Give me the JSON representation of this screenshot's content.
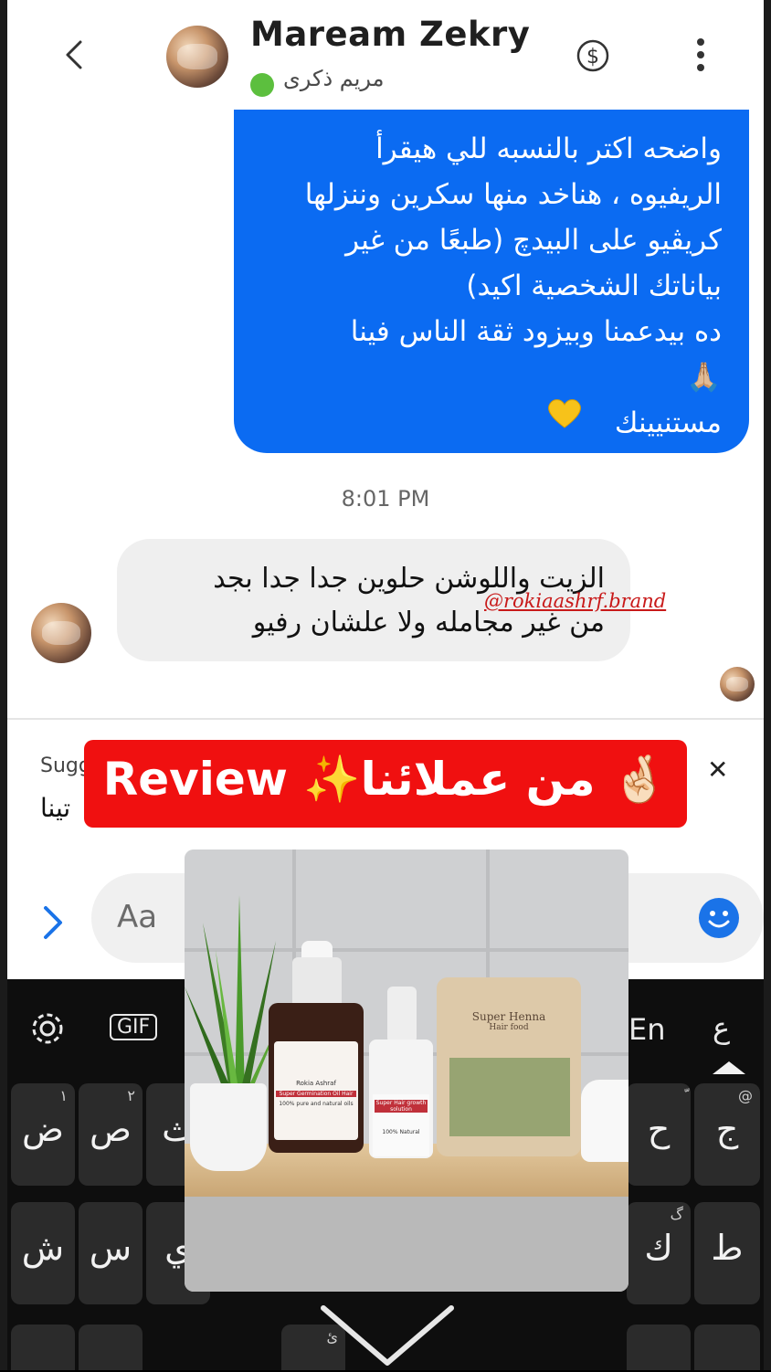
{
  "header": {
    "contact_name": "Maream Zekry",
    "contact_subname": "مريم ذكرى",
    "back_icon": "chevron-left-icon",
    "payment_icon": "dollar-circle-icon",
    "more_icon": "vertical-ellipsis-icon"
  },
  "sent_message": {
    "lines": [
      "واضحه اكتر بالنسبه للي هيقرأ",
      "الريفيوه ، هناخد منها سكرين وننزلها",
      "كريڤيو على البيدچ (طبعًا من غير",
      "بياناتك الشخصية اكيد)",
      "ده بيدعمنا وبيزود ثقة الناس فينا",
      "🙏🏼",
      "مستنيينك"
    ],
    "emoji": "yellow-heart-icon"
  },
  "timestamp": "8:01 PM",
  "received_message": {
    "lines": [
      "الزيت واللوشن حلوين جدا جدا بجد",
      "من غير مجامله ولا علشان رفيو"
    ]
  },
  "watermark": "@rokiaashrf.brand",
  "suggestion": {
    "label": "Sugg",
    "text": "تينا"
  },
  "composer": {
    "placeholder": "Aa",
    "expand_icon": "chevron-right-icon",
    "emoji_icon": "smiley-icon"
  },
  "banner": {
    "latin": "Review",
    "arabic": "من عملائنا✨",
    "emoji": "🤞🏻"
  },
  "keyboard": {
    "toolbar": {
      "settings_icon": "gear-icon",
      "gif_label": "GIF",
      "lang_label": "En",
      "alt_char": "ع"
    },
    "row1": [
      {
        "char": "ض",
        "sup": "١"
      },
      {
        "char": "ص",
        "sup": "٢"
      },
      {
        "char": "ث",
        "sup": ""
      },
      {
        "char": "ح",
        "sup": "ّ"
      },
      {
        "char": "ج",
        "sup": "@"
      }
    ],
    "row2": [
      {
        "char": "ش",
        "sup": ""
      },
      {
        "char": "س",
        "sup": ""
      },
      {
        "char": "ي",
        "sup": ""
      },
      {
        "char": "ك",
        "sup": "گ"
      },
      {
        "char": "ط",
        "sup": ""
      }
    ],
    "row3_hint": "ئ"
  },
  "product_photo": {
    "bottle1_label": "Super Germination Oil Hair",
    "bottle1_sub": "100% pure and natural oils",
    "bottle2_label": "Super Hair growth solution",
    "bottle2_sub": "100% Natural",
    "pouch_title": "Super Henna",
    "pouch_sub": "Hair food",
    "brand": "Rokia Ashraf"
  },
  "colors": {
    "sent_bubble": "#0b6bf2",
    "received_bubble": "#efefef",
    "online_dot": "#5cbf3e",
    "banner": "#f01010",
    "accent": "#1a73e8"
  }
}
